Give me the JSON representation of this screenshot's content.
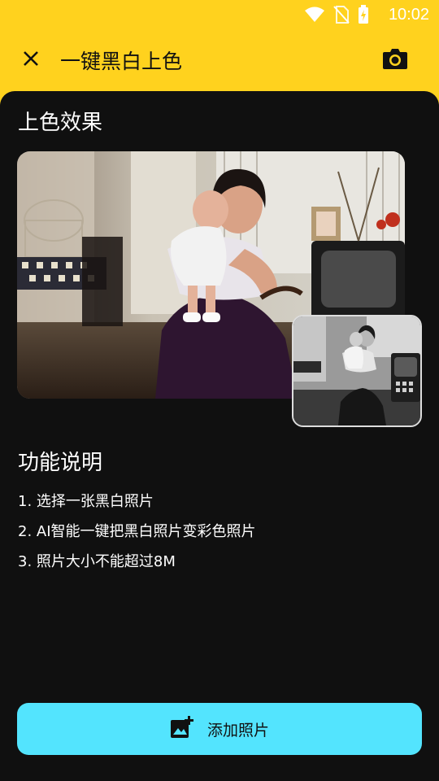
{
  "status": {
    "time": "10:02"
  },
  "app_bar": {
    "title": "一键黑白上色"
  },
  "effect_section": {
    "title": "上色效果"
  },
  "features_section": {
    "title": "功能说明",
    "items": [
      "1. 选择一张黑白照片",
      "2. AI智能一键把黑白照片变彩色照片",
      "3. 照片大小不能超过8M"
    ]
  },
  "add_button": {
    "label": "添加照片"
  },
  "colors": {
    "accent_yellow": "#FFD21E",
    "button_cyan": "#53E4FE",
    "background_dark": "#101010"
  },
  "icons": [
    "wifi-icon",
    "no-sim-icon",
    "battery-charging-icon",
    "close-icon",
    "camera-icon",
    "add-photo-icon"
  ]
}
